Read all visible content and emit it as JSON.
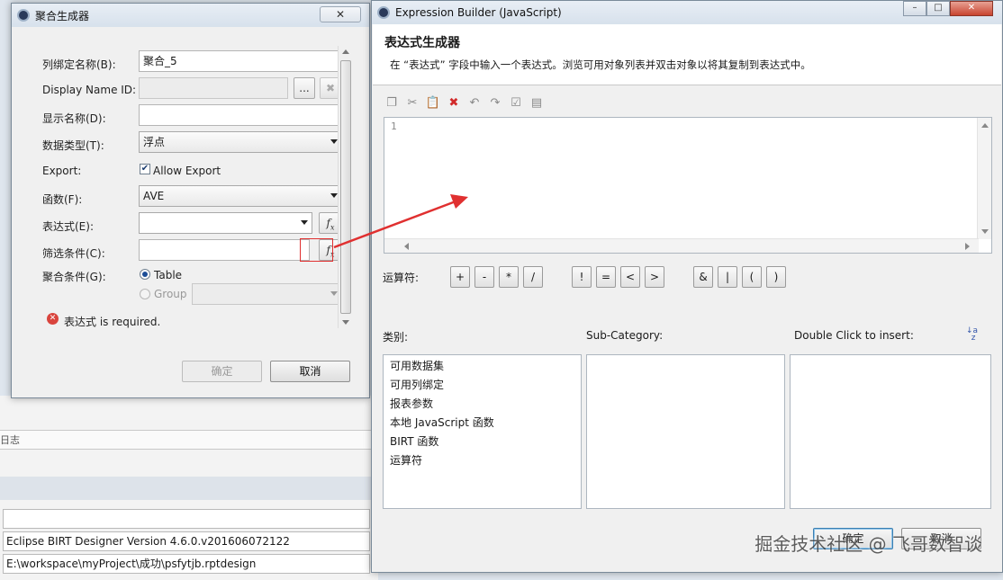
{
  "background": {
    "log_label": "日志",
    "version_text": "Eclipse BIRT Designer Version 4.6.0.v201606072122",
    "path_text": "E:\\workspace\\myProject\\成功\\psfytjb.rptdesign"
  },
  "aggregation_dialog": {
    "title": "聚合生成器",
    "labels": {
      "binding_name": "列绑定名称(B):",
      "display_name_id": "Display Name ID:",
      "display_name": "显示名称(D):",
      "data_type": "数据类型(T):",
      "export": "Export:",
      "function": "函数(F):",
      "expression": "表达式(E):",
      "filter": "筛选条件(C):",
      "aggregate_on": "聚合条件(G):"
    },
    "values": {
      "binding_name": "聚合_5",
      "display_name_id": "",
      "display_name": "",
      "data_type": "浮点",
      "allow_export": "Allow Export",
      "function": "AVE",
      "expression": "",
      "filter": "",
      "table_option": "Table",
      "group_option": "Group",
      "group_value": ""
    },
    "browse_glyph": "...",
    "clear_glyph": "✖",
    "error_message": "表达式 is required.",
    "ok_label": "确定",
    "cancel_label": "取消"
  },
  "expression_builder": {
    "title": "Expression Builder (JavaScript)",
    "header_title": "表达式生成器",
    "description": "在 “表达式” 字段中输入一个表达式。浏览可用对象列表并双击对象以将其复制到表达式中。",
    "line_number": "1",
    "toolbar_icons": [
      "copy-icon",
      "cut-icon",
      "paste-icon",
      "delete-icon",
      "undo-icon",
      "redo-icon",
      "validate-icon",
      "calendar-icon"
    ],
    "operators_label": "运算符:",
    "operators": [
      "+",
      "-",
      "*",
      "/",
      "!",
      "=",
      "<",
      ">",
      "&",
      "|",
      "(",
      ")"
    ],
    "category_label": "类别:",
    "subcategory_label": "Sub-Category:",
    "insert_label": "Double Click to insert:",
    "categories": [
      "可用数据集",
      "可用列绑定",
      "报表参数",
      "本地 JavaScript 函数",
      "BIRT 函数",
      "运算符"
    ],
    "ok_label": "确定",
    "cancel_label": "取消"
  },
  "watermark": "掘金技术社区 @ 飞哥数智谈",
  "colors": {
    "annotation_red": "#e03030",
    "error_red": "#d9443d",
    "selection_blue": "#1b4d96"
  }
}
